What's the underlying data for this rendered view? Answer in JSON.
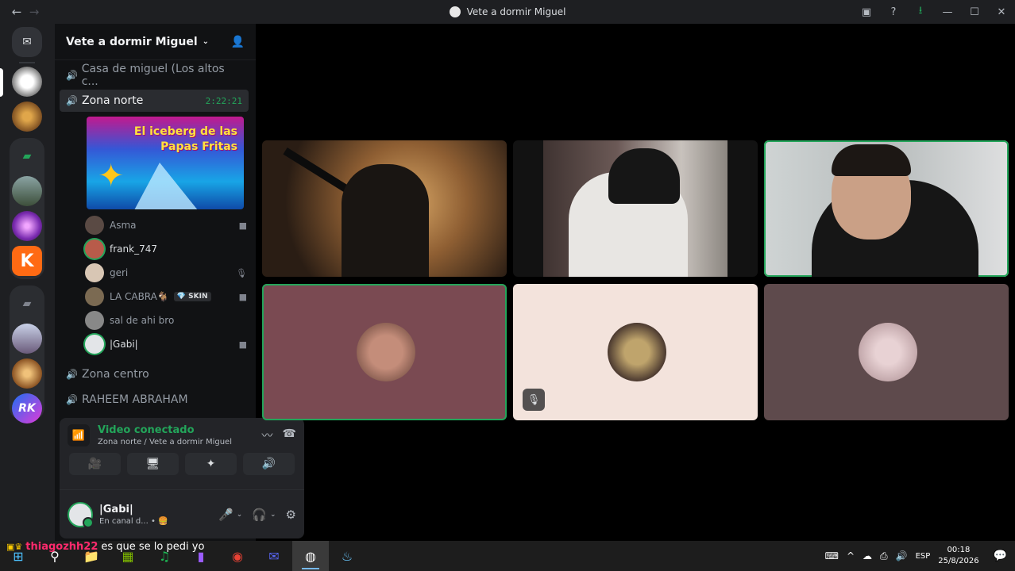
{
  "window": {
    "title": "Vete a dormir Miguel",
    "nav_back": "←",
    "nav_forward": "→",
    "btn_inbox": "▣",
    "btn_help": "?",
    "btn_download": "⭳",
    "btn_minimize": "—",
    "btn_maximize": "☐",
    "btn_close": "✕"
  },
  "rail": {
    "home_glyph": "✉",
    "servers": [
      "ghost-server",
      "monkey-server",
      "folder-green",
      "photo-server",
      "orb-server",
      "K",
      "folder-grey",
      "anime-server",
      "lion-server",
      "RK"
    ]
  },
  "sidebar": {
    "server_name": "Vete a dormir Miguel",
    "chevron": "⌄",
    "invite_glyph": "👤",
    "channels": [
      {
        "name": "Casa de miguel (Los altos c...",
        "glyph": "🔊"
      },
      {
        "name": "Zona norte",
        "glyph": "🔊",
        "timer": "2:22:21",
        "active": true
      },
      {
        "name": "Zona centro",
        "glyph": "🔊"
      },
      {
        "name": "RAHEEM ABRAHAM",
        "glyph": "🔊"
      }
    ],
    "stream_title": "El iceberg de las Papas Fritas",
    "members": [
      {
        "name": "Asma",
        "status_glyph": "■",
        "color": "#5a4a44"
      },
      {
        "name": "frank_747",
        "status_glyph": "",
        "color": "#b85b4a",
        "speaking": true
      },
      {
        "name": "geri",
        "status_glyph": "🎙",
        "color": "#d8c6b4"
      },
      {
        "name": "LA CABRA🐐",
        "badge_icon": "💎",
        "badge_text": "SKIN",
        "status_glyph": "■",
        "color": "#7b6a52"
      },
      {
        "name": "sal de ahi bro",
        "status_glyph": "",
        "color": "#888888"
      },
      {
        "name": "|Gabi|",
        "status_glyph": "■",
        "color": "#e3e5e8",
        "speaking": true
      }
    ]
  },
  "voice": {
    "status": "Video conectado",
    "location": "Zona norte / Vete a dormir Miguel",
    "signal_glyph": "📶",
    "noise_glyph": "〰",
    "disconnect_glyph": "☎",
    "btn_camera": "🎥",
    "btn_screen": "🖥",
    "btn_activity": "✦",
    "btn_soundboard": "🔊"
  },
  "user": {
    "name": "|Gabi|",
    "status": "En canal d... • 🍔",
    "mic_glyph": "🎤",
    "headset_glyph": "🎧",
    "settings_glyph": "⚙",
    "caret": "⌄"
  },
  "video_tiles": [
    {
      "kind": "camera",
      "speaking": false
    },
    {
      "kind": "camera",
      "speaking": false
    },
    {
      "kind": "camera",
      "speaking": true
    },
    {
      "kind": "avatar",
      "bg": "#7a4a52",
      "avatar": "#c48d7a",
      "speaking": true
    },
    {
      "kind": "avatar",
      "bg": "#f3e3dc",
      "avatar": "#bfa46c",
      "muted": true,
      "mute_glyph": "🎙"
    },
    {
      "kind": "avatar",
      "bg": "#5e4a4c",
      "avatar": "#d8b8bc"
    }
  ],
  "chat": {
    "icons": "▣♛",
    "user": "thiagozhh22",
    "message": "es que se lo pedi yo"
  },
  "taskbar": {
    "apps": [
      "⊞",
      "⚲",
      "📁",
      "▦",
      "♫",
      "▮",
      "◉",
      "✉",
      "◍",
      "♨"
    ],
    "tray_icons": [
      "⌨",
      "^",
      "☁",
      "⎙",
      "🔊"
    ],
    "lang": "ESP",
    "time": "00:18",
    "date": "25/8/2026",
    "notif_glyph": "💬"
  }
}
